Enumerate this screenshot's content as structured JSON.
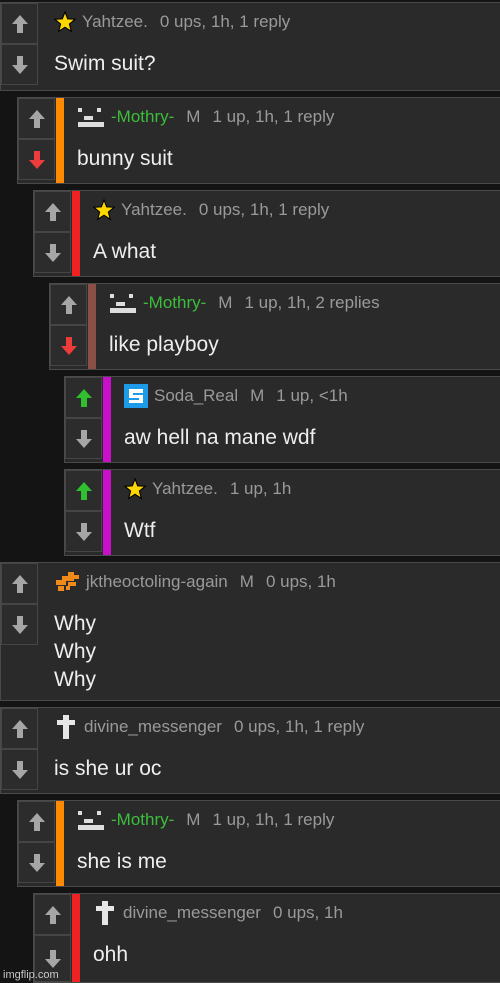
{
  "colors": {
    "background": "#141414",
    "card": "#2a2a2a",
    "upvoted": "#2fbf2f",
    "downvoted": "#ee3b3b",
    "orange_bar": "#ff8a00",
    "red_bar": "#ee2222",
    "brown_bar": "#8a5048",
    "magenta_bar": "#c810c8"
  },
  "comments": [
    {
      "user": "Yahtzee.",
      "mod": "",
      "stats": "0 ups, 1h, 1 reply",
      "text": [
        "Swim suit?"
      ],
      "avatar": "star-icon",
      "vote": "none"
    },
    {
      "user": "-Mothry-",
      "mod": "M",
      "stats": "1 up, 1h, 1 reply",
      "text": [
        "bunny suit"
      ],
      "avatar": "pixel-face-icon",
      "vote": "down"
    },
    {
      "user": "Yahtzee.",
      "mod": "",
      "stats": "0 ups, 1h, 1 reply",
      "text": [
        "A what"
      ],
      "avatar": "star-icon",
      "vote": "none"
    },
    {
      "user": "-Mothry-",
      "mod": "M",
      "stats": "1 up, 1h, 2 replies",
      "text": [
        "like playboy"
      ],
      "avatar": "pixel-face-icon",
      "vote": "down"
    },
    {
      "user": "Soda_Real",
      "mod": "M",
      "stats": "1 up, <1h",
      "text": [
        "aw hell na mane wdf"
      ],
      "avatar": "blue-s-icon",
      "vote": "up"
    },
    {
      "user": "Yahtzee.",
      "mod": "",
      "stats": "1 up, 1h",
      "text": [
        "Wtf"
      ],
      "avatar": "star-icon",
      "vote": "up"
    },
    {
      "user": "jktheoctoling-again",
      "mod": "M",
      "stats": "0 ups, 1h",
      "text": [
        "Why",
        "Why",
        "Why"
      ],
      "avatar": "orange-octoling-icon",
      "vote": "none"
    },
    {
      "user": "divine_messenger",
      "mod": "",
      "stats": "0 ups, 1h, 1 reply",
      "text": [
        "is she ur oc"
      ],
      "avatar": "cross-icon",
      "vote": "none"
    },
    {
      "user": "-Mothry-",
      "mod": "M",
      "stats": "1 up, 1h, 1 reply",
      "text": [
        "she is me"
      ],
      "avatar": "pixel-face-icon",
      "vote": "none"
    },
    {
      "user": "divine_messenger",
      "mod": "",
      "stats": "0 ups, 1h",
      "text": [
        "ohh"
      ],
      "avatar": "cross-icon",
      "vote": "none"
    }
  ],
  "watermark": "imgflip.com"
}
